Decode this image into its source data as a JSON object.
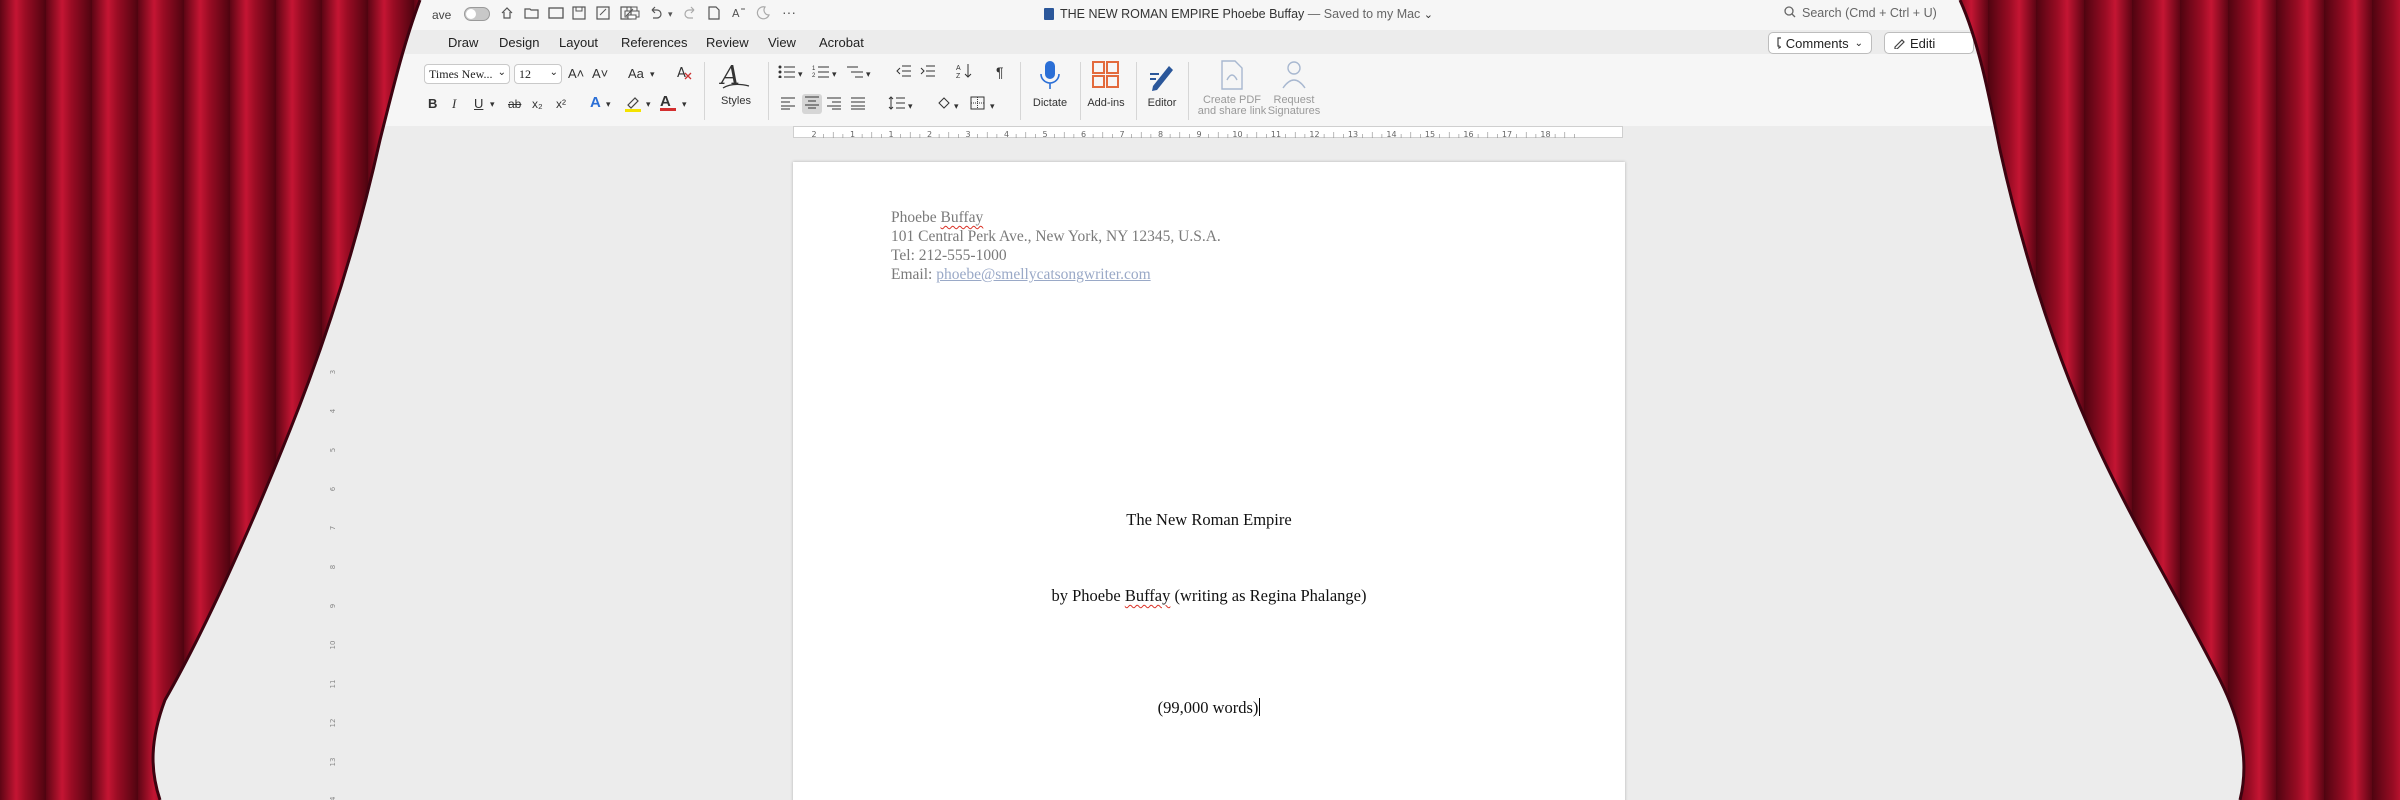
{
  "window": {
    "autosave_label": "ave",
    "doc_title": "THE NEW ROMAN EMPIRE Phoebe Buffay",
    "doc_status": " — Saved to my Mac",
    "doc_title_chevron": "⌄",
    "search_placeholder": "Search (Cmd + Ctrl + U)",
    "more": "···"
  },
  "tabs": [
    "Draw",
    "Design",
    "Layout",
    "References",
    "Review",
    "View",
    "Acrobat"
  ],
  "actions": {
    "comments": "Comments",
    "editing": "Editi"
  },
  "ribbon": {
    "font_name": "Times New...",
    "font_size": "12",
    "grow_font": "A˄",
    "shrink_font": "A˅",
    "change_case": "Aa",
    "bold": "B",
    "italic": "I",
    "underline": "U",
    "strikethrough": "ab",
    "subscript": "x₂",
    "superscript": "x²",
    "text_effects": "A",
    "font_color": "A",
    "pilcrow": "¶",
    "styles_label": "Styles",
    "dictate_label": "Dictate",
    "addins_label": "Add-ins",
    "editor_label": "Editor",
    "create_pdf_label_1": "Create PDF",
    "create_pdf_label_2": "and share link",
    "request_sig_label_1": "Request",
    "request_sig_label_2": "Signatures",
    "colors": {
      "highlight": "#f4e300",
      "font_color": "#d32f2f",
      "dictate": "#2b6fd6",
      "addins": "#e36a3c",
      "editor": "#2b579a"
    }
  },
  "ruler": {
    "h_labels": [
      "2",
      "1",
      "1",
      "2",
      "3",
      "4",
      "5",
      "6",
      "7",
      "8",
      "9",
      "10",
      "11",
      "12",
      "13",
      "14",
      "15",
      "16",
      "17",
      "18"
    ],
    "v_labels": [
      "3",
      "4",
      "5",
      "6",
      "7",
      "8",
      "9",
      "10",
      "11",
      "12",
      "13",
      "14"
    ]
  },
  "document": {
    "author_name_first": "Phoebe ",
    "author_name_last": "Buffay",
    "address": "101 Central Perk Ave., New York, NY 12345, U.S.A.",
    "tel": "Tel: 212-555-1000",
    "email_label": "Email: ",
    "email": "phoebe@smellycatsongwriter.com",
    "title": "The New Roman Empire",
    "byline_pre": "by Phoebe ",
    "byline_name": "Buffay",
    "byline_post": " (writing as Regina Phalange)",
    "word_count": "(99,000 words)"
  },
  "colors": {
    "curtain": "#b0102a",
    "curtain_dark": "#6a0616",
    "spelling": "#d93025"
  }
}
